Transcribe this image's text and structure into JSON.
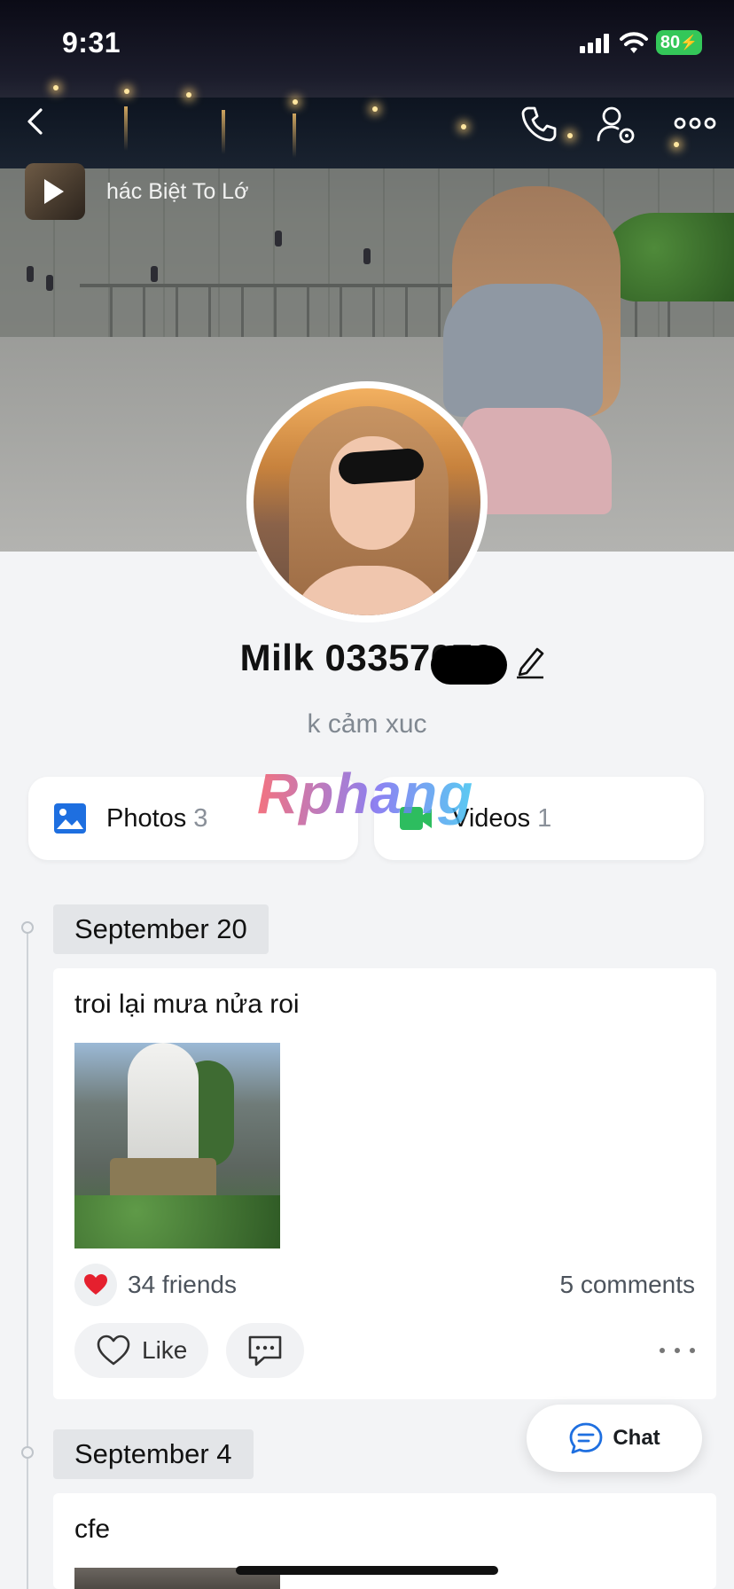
{
  "status_bar": {
    "time": "9:31",
    "battery": "80"
  },
  "cover": {
    "music_title": "hác Biệt To Lớ"
  },
  "profile": {
    "name": "Milk 03357078",
    "bio": "k cảm xuc"
  },
  "media": {
    "photos_label": "Photos",
    "photos_count": "3",
    "videos_label": "Videos",
    "videos_count": "1"
  },
  "watermark": "Rphang",
  "posts": [
    {
      "date": "September 20",
      "text": "troi lại mưa nửa roi",
      "friends": "34 friends",
      "comments": "5 comments",
      "like_label": "Like"
    },
    {
      "date": "September 4",
      "text": "cfe"
    }
  ],
  "chat_button": {
    "label": "Chat"
  },
  "colors": {
    "accent": "#1e6fe0",
    "video_green": "#2dbd5f",
    "heart_red": "#e5202e",
    "battery_green": "#34c759"
  },
  "icons": [
    "back-icon",
    "call-icon",
    "profile-settings-icon",
    "more-icon",
    "edit-icon",
    "photos-icon",
    "video-camera-icon",
    "heart-icon",
    "comment-icon",
    "chat-bubble-icon",
    "play-icon"
  ]
}
